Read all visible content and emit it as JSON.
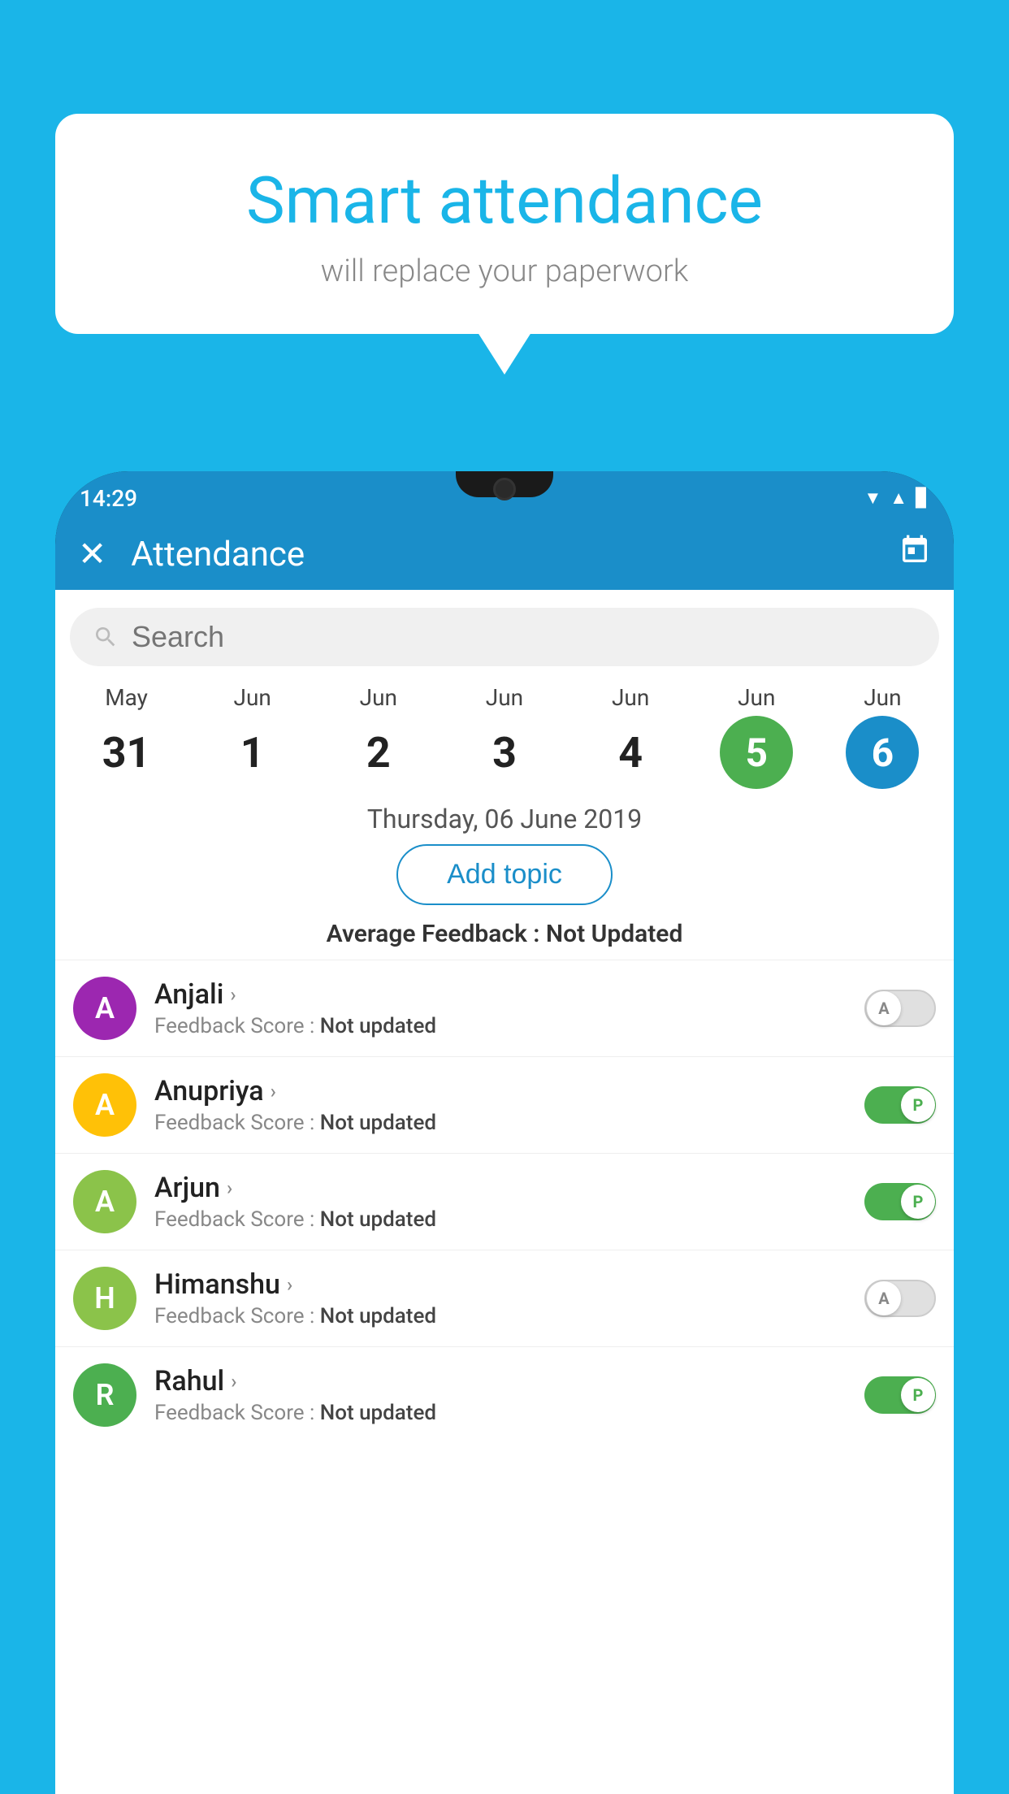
{
  "background_color": "#1ab5e8",
  "bubble": {
    "title": "Smart attendance",
    "subtitle": "will replace your paperwork"
  },
  "status_bar": {
    "time": "14:29",
    "wifi": "▼",
    "signal": "▲",
    "battery": "▌"
  },
  "header": {
    "title": "Attendance",
    "close_label": "×",
    "calendar_icon": "📅"
  },
  "search": {
    "placeholder": "Search"
  },
  "calendar": {
    "dates": [
      {
        "month": "May",
        "day": "31",
        "style": "normal"
      },
      {
        "month": "Jun",
        "day": "1",
        "style": "normal"
      },
      {
        "month": "Jun",
        "day": "2",
        "style": "normal"
      },
      {
        "month": "Jun",
        "day": "3",
        "style": "normal"
      },
      {
        "month": "Jun",
        "day": "4",
        "style": "normal"
      },
      {
        "month": "Jun",
        "day": "5",
        "style": "today"
      },
      {
        "month": "Jun",
        "day": "6",
        "style": "selected"
      }
    ]
  },
  "selected_date": "Thursday, 06 June 2019",
  "add_topic_label": "Add topic",
  "avg_feedback_label": "Average Feedback :",
  "avg_feedback_value": "Not Updated",
  "students": [
    {
      "name": "Anjali",
      "avatar_letter": "A",
      "avatar_color": "#9c27b0",
      "feedback_label": "Feedback Score :",
      "feedback_value": "Not updated",
      "toggle_state": "off",
      "toggle_letter": "A"
    },
    {
      "name": "Anupriya",
      "avatar_letter": "A",
      "avatar_color": "#ffc107",
      "feedback_label": "Feedback Score :",
      "feedback_value": "Not updated",
      "toggle_state": "on",
      "toggle_letter": "P"
    },
    {
      "name": "Arjun",
      "avatar_letter": "A",
      "avatar_color": "#8bc34a",
      "feedback_label": "Feedback Score :",
      "feedback_value": "Not updated",
      "toggle_state": "on",
      "toggle_letter": "P"
    },
    {
      "name": "Himanshu",
      "avatar_letter": "H",
      "avatar_color": "#8bc34a",
      "feedback_label": "Feedback Score :",
      "feedback_value": "Not updated",
      "toggle_state": "off",
      "toggle_letter": "A"
    },
    {
      "name": "Rahul",
      "avatar_letter": "R",
      "avatar_color": "#4caf50",
      "feedback_label": "Feedback Score :",
      "feedback_value": "Not updated",
      "toggle_state": "on",
      "toggle_letter": "P"
    }
  ]
}
